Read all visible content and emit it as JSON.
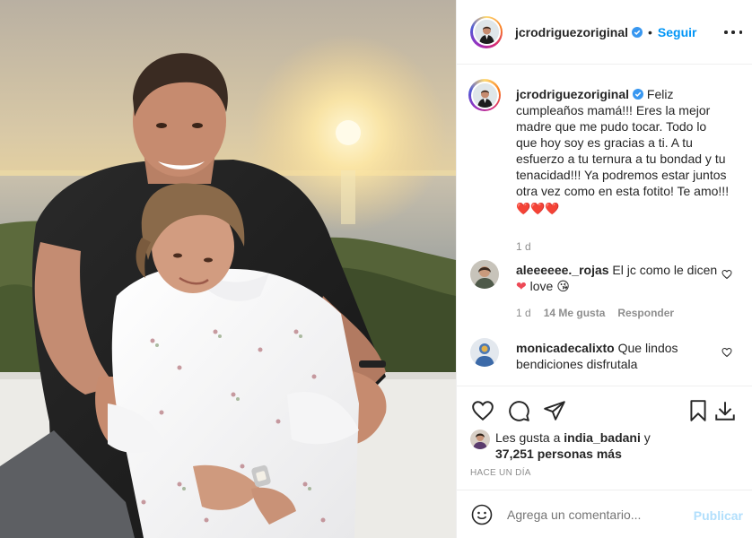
{
  "post": {
    "username": "jcrodriguezoriginal",
    "verified": true,
    "separator": "•",
    "follow_label": "Seguir",
    "caption_username": "jcrodriguezoriginal",
    "caption_text": "Feliz cumpleaños mamá!!! Eres la mejor madre que me pudo tocar. Todo lo que hoy soy es gracias a ti. A tu esfuerzo a tu ternura a tu bondad y tu tenacidad!!! Ya podremos estar juntos otra vez como en esta fotito! Te amo!!!",
    "caption_emoji": "❤️❤️❤️",
    "caption_time": "1 d"
  },
  "comments": [
    {
      "username": "aleeeeee._rojas",
      "text": "El jc como le dicen",
      "text_suffix": "love",
      "time": "1 d",
      "likes": "14 Me gusta",
      "reply": "Responder"
    },
    {
      "username": "monicadecalixto",
      "text": "Que lindos bendiciones disfrutala"
    }
  ],
  "likes": {
    "prefix": "Les gusta a",
    "liked_by": "india_badani",
    "conjunction": "y",
    "others": "37,251 personas más"
  },
  "posted_time": "HACE UN DÍA",
  "add_comment": {
    "placeholder": "Agrega un comentario...",
    "publish_label": "Publicar"
  },
  "colors": {
    "accent": "#0095f6",
    "publish_disabled": "#b2dffc",
    "heart": "#ed4956",
    "border": "#efefef",
    "muted": "#8e8e8e"
  }
}
